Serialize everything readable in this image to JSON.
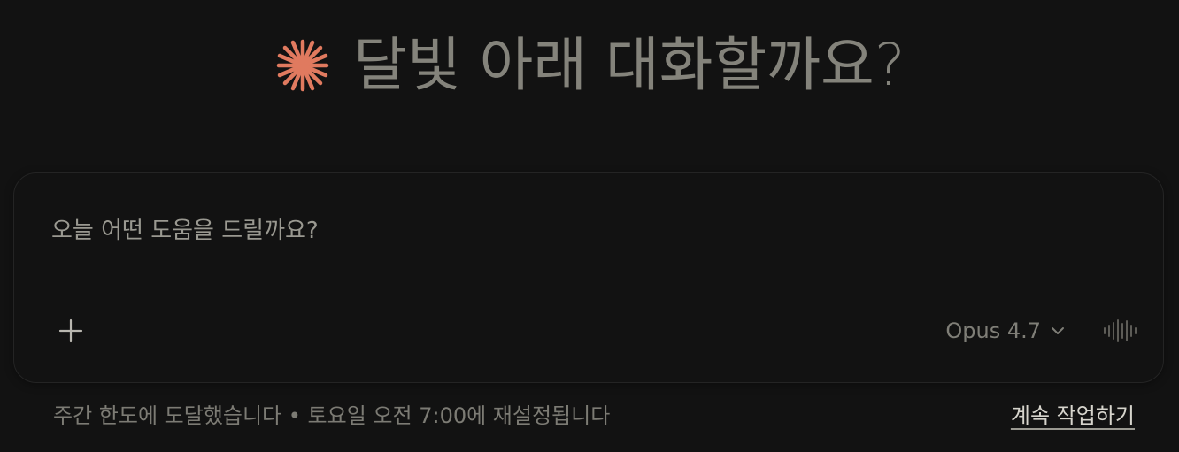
{
  "greeting": {
    "logo_icon": "sparkle-asterisk-icon",
    "logo_color": "#e07a5f",
    "title": "달빛 아래 대화할까요?"
  },
  "composer": {
    "placeholder": "오늘 어떤 도움을 드릴까요?",
    "add_icon": "plus-icon",
    "model_label": "Opus 4.7",
    "model_chevron_icon": "chevron-down-icon",
    "voice_icon": "voice-waveform-icon"
  },
  "footer": {
    "limit_notice": "주간 한도에 도달했습니다 • 토요일 오전 7:00에 재설정됩니다",
    "continue_link": "계속 작업하기"
  }
}
